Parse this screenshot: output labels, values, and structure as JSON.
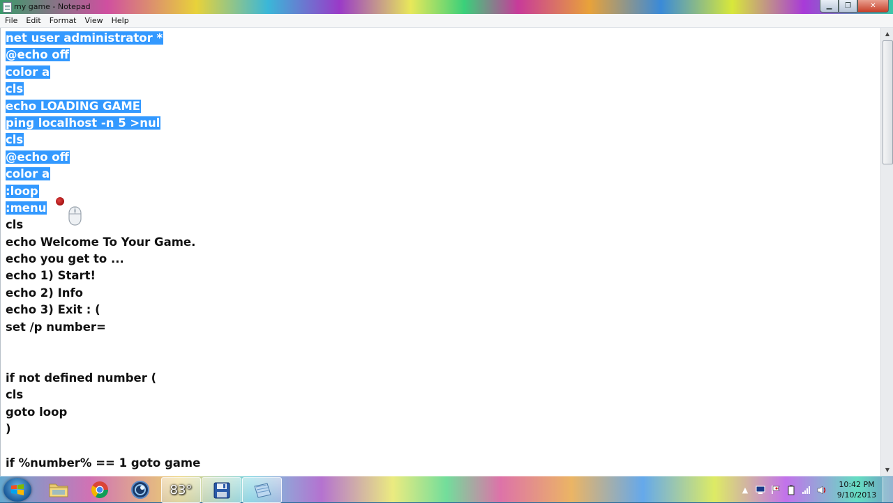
{
  "window": {
    "title": "my game - Notepad",
    "buttons": {
      "minimize": "▁",
      "maximize": "❐",
      "close": "✕"
    }
  },
  "menu": [
    "File",
    "Edit",
    "Format",
    "View",
    "Help"
  ],
  "editor": {
    "lines": [
      {
        "text": "net user administrator *",
        "selected": true
      },
      {
        "text": "@echo off",
        "selected": true
      },
      {
        "text": "color a",
        "selected": true
      },
      {
        "text": "cls",
        "selected": true
      },
      {
        "text": "echo LOADING GAME",
        "selected": true
      },
      {
        "text": "ping localhost -n 5 >nul",
        "selected": true
      },
      {
        "text": "cls",
        "selected": true
      },
      {
        "text": "@echo off",
        "selected": true
      },
      {
        "text": "color a",
        "selected": true
      },
      {
        "text": ":loop",
        "selected": true
      },
      {
        "text": ":menu",
        "selected": true
      },
      {
        "text": "cls",
        "selected": false
      },
      {
        "text": "echo Welcome To Your Game.",
        "selected": false
      },
      {
        "text": "echo you get to ...",
        "selected": false
      },
      {
        "text": "echo 1) Start!",
        "selected": false
      },
      {
        "text": "echo 2) Info",
        "selected": false
      },
      {
        "text": "echo 3) Exit : (",
        "selected": false
      },
      {
        "text": "set /p number=",
        "selected": false
      },
      {
        "text": "",
        "selected": false
      },
      {
        "text": "",
        "selected": false
      },
      {
        "text": "if not defined number (",
        "selected": false
      },
      {
        "text": "cls",
        "selected": false
      },
      {
        "text": "goto loop",
        "selected": false
      },
      {
        "text": ")",
        "selected": false
      },
      {
        "text": "",
        "selected": false
      },
      {
        "text": "if %number% == 1 goto game",
        "selected": false
      }
    ],
    "selection_color": "#3399ff"
  },
  "taskbar": {
    "weather_text": "83°",
    "clock_time": "10:42 PM",
    "clock_date": "9/10/2013",
    "tray_icons": [
      "show-hidden-icons-arrow",
      "network-device-icon",
      "flag-icon",
      "battery-icon",
      "signal-bars-icon",
      "volume-icon"
    ]
  }
}
